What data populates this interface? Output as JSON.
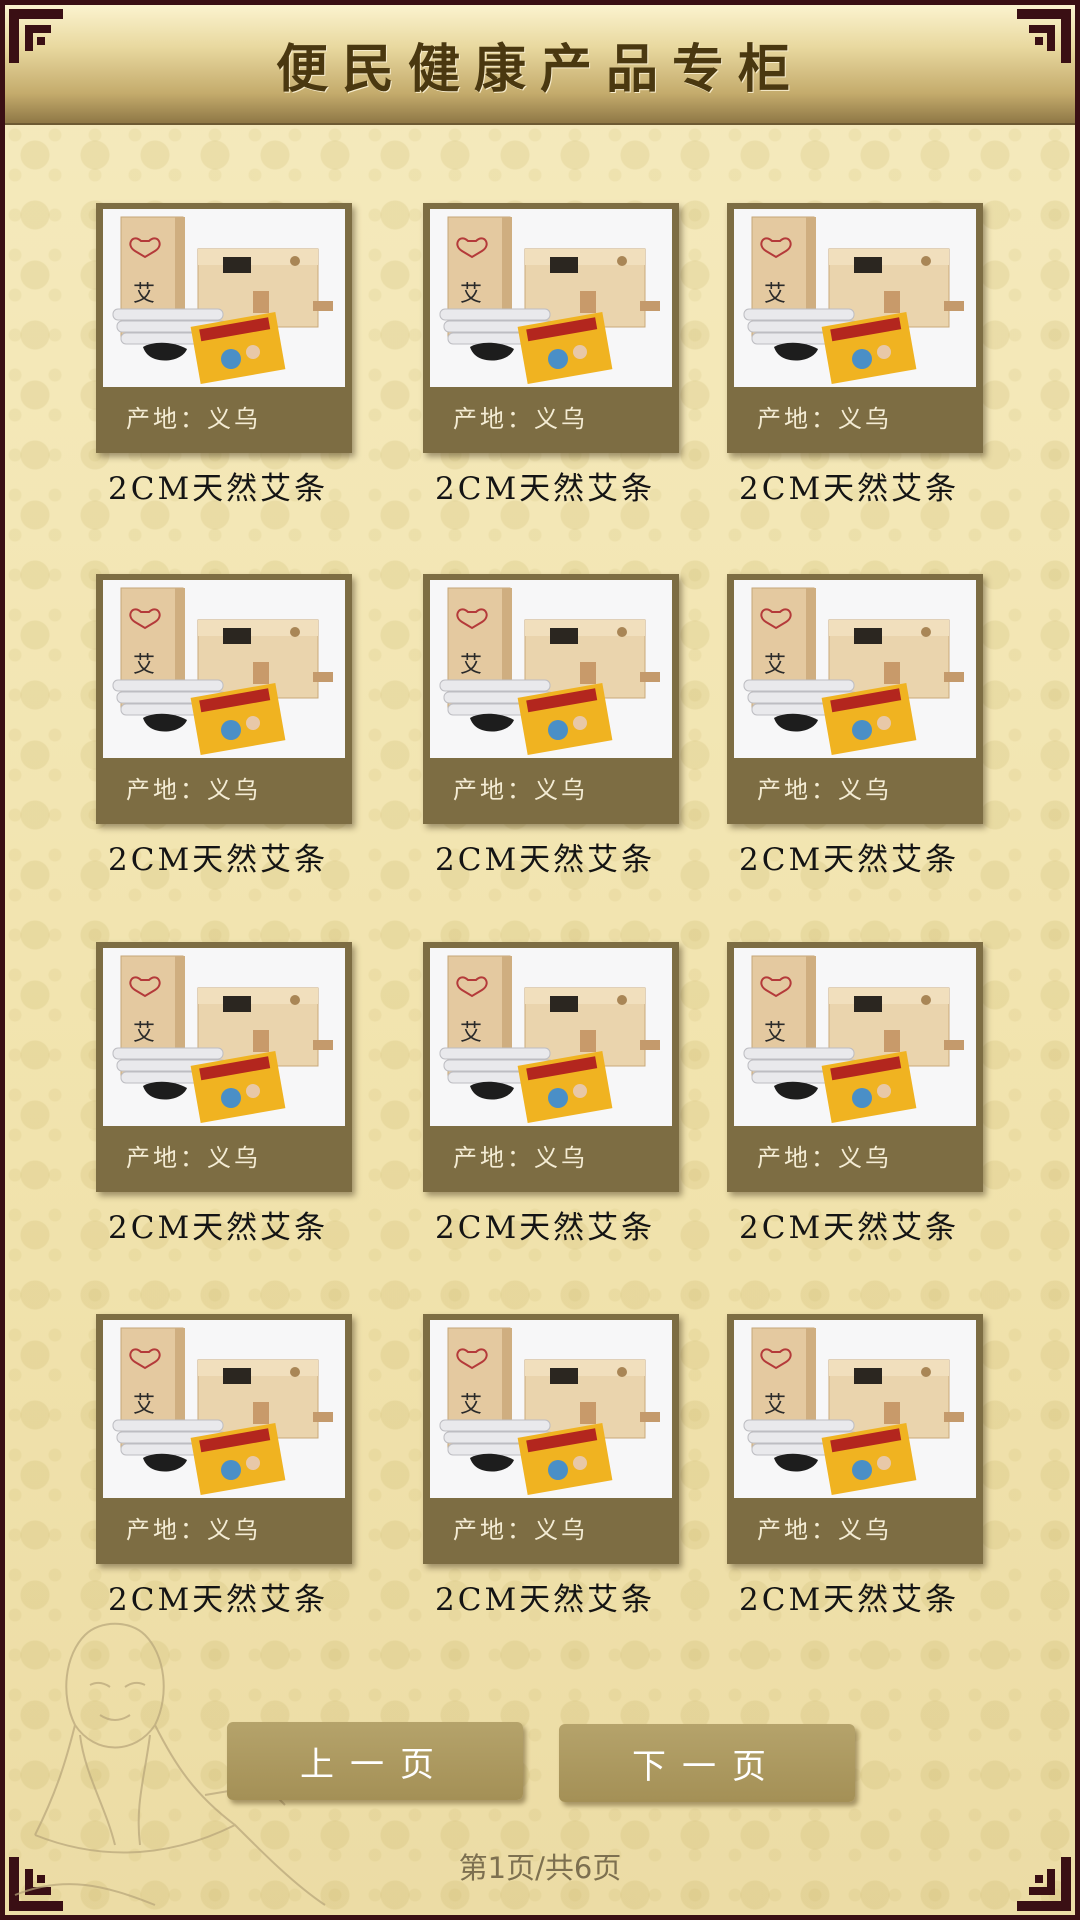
{
  "header": {
    "title": "便民健康产品专柜"
  },
  "products": [
    {
      "origin": "产地：义乌",
      "name": "2CM天然艾条"
    },
    {
      "origin": "产地：义乌",
      "name": "2CM天然艾条"
    },
    {
      "origin": "产地：义乌",
      "name": "2CM天然艾条"
    },
    {
      "origin": "产地：义乌",
      "name": "2CM天然艾条"
    },
    {
      "origin": "产地：义乌",
      "name": "2CM天然艾条"
    },
    {
      "origin": "产地：义乌",
      "name": "2CM天然艾条"
    },
    {
      "origin": "产地：义乌",
      "name": "2CM天然艾条"
    },
    {
      "origin": "产地：义乌",
      "name": "2CM天然艾条"
    },
    {
      "origin": "产地：义乌",
      "name": "2CM天然艾条"
    },
    {
      "origin": "产地：义乌",
      "name": "2CM天然艾条"
    },
    {
      "origin": "产地：义乌",
      "name": "2CM天然艾条"
    },
    {
      "origin": "产地：义乌",
      "name": "2CM天然艾条"
    }
  ],
  "buttons": {
    "prev": "上一页",
    "next": "下一页"
  },
  "pager": {
    "text": "第1页/共6页"
  },
  "colors": {
    "frame": "#3a0f14",
    "card": "#7d6d43",
    "button": "#a99659",
    "background": "#f3e6b3"
  }
}
